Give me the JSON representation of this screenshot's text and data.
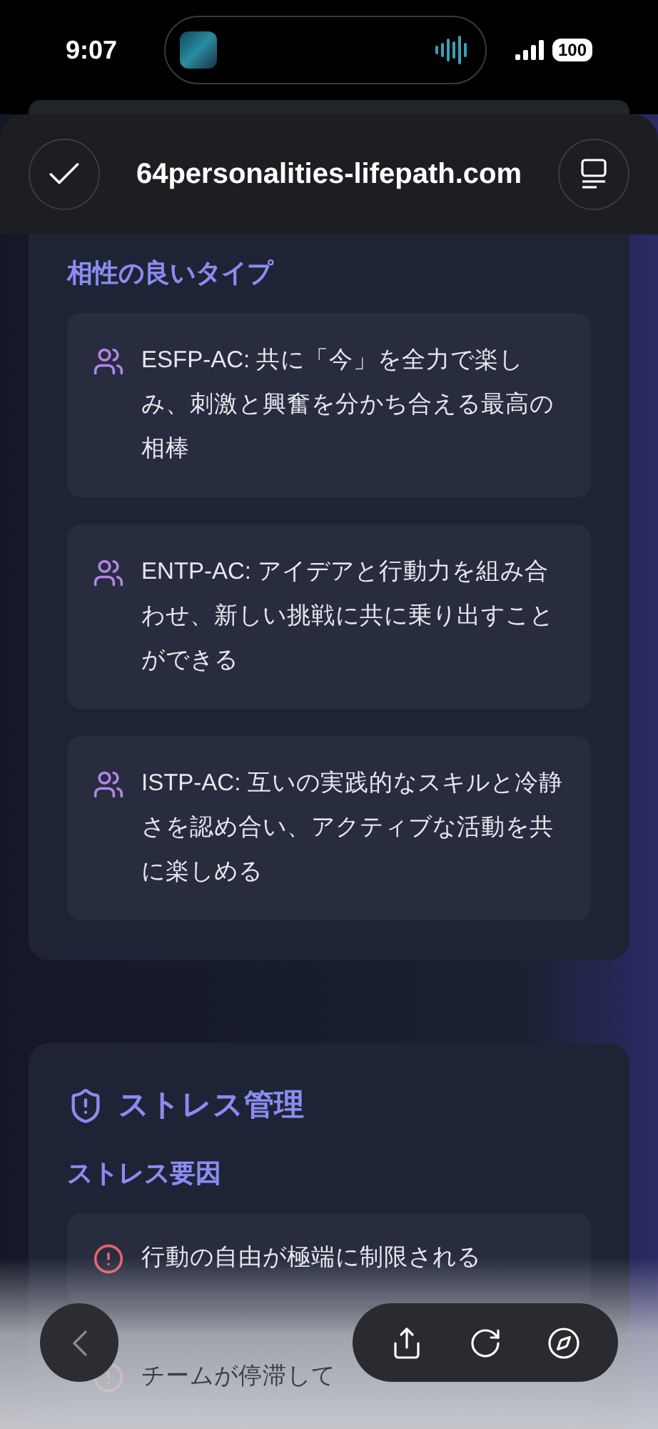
{
  "status_bar": {
    "time": "9:07",
    "battery": "100"
  },
  "browser": {
    "url": "64personalities-lifepath.com"
  },
  "compatible": {
    "title": "相性の良いタイプ",
    "items": [
      {
        "text": "ESFP-AC: 共に「今」を全力で楽しみ、刺激と興奮を分かち合える最高の相棒"
      },
      {
        "text": "ENTP-AC: アイデアと行動力を組み合わせ、新しい挑戦に共に乗り出すことができる"
      },
      {
        "text": "ISTP-AC: 互いの実践的なスキルと冷静さを認め合い、アクティブな活動を共に楽しめる"
      }
    ]
  },
  "stress": {
    "heading": "ストレス管理",
    "subheading": "ストレス要因",
    "items": [
      {
        "text": "行動の自由が極端に制限される"
      },
      {
        "text": "チームが停滞して"
      }
    ]
  }
}
